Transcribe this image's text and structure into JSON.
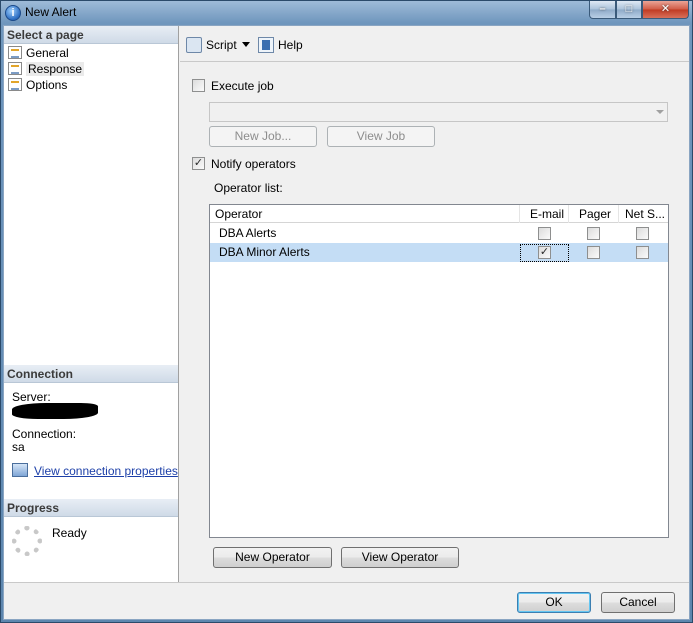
{
  "window": {
    "title": "New Alert",
    "app_icon": "info-icon",
    "controls": {
      "minimize": "minimize-icon",
      "maximize": "maximize-icon",
      "close": "close-icon"
    }
  },
  "left": {
    "select_page_header": "Select a page",
    "pages": [
      {
        "label": "General",
        "selected": false
      },
      {
        "label": "Response",
        "selected": true
      },
      {
        "label": "Options",
        "selected": false
      }
    ],
    "connection_header": "Connection",
    "server_label": "Server:",
    "connection_label": "Connection:",
    "connection_value": "sa",
    "view_props_link": "View connection properties",
    "progress_header": "Progress",
    "progress_status": "Ready"
  },
  "toolbar": {
    "script_label": "Script",
    "help_label": "Help"
  },
  "response": {
    "execute_job_label": "Execute job",
    "execute_job_checked": false,
    "job_combo_value": "",
    "new_job_label": "New Job...",
    "view_job_label": "View Job",
    "notify_operators_label": "Notify operators",
    "notify_operators_checked": true,
    "operator_list_label": "Operator list:",
    "columns": [
      "Operator",
      "E-mail",
      "Pager",
      "Net S..."
    ],
    "operators": [
      {
        "name": "DBA Alerts",
        "email": false,
        "pager": false,
        "net_send": false
      },
      {
        "name": "DBA Minor Alerts",
        "email": true,
        "pager": false,
        "net_send": false
      }
    ],
    "new_operator_label": "New Operator",
    "view_operator_label": "View Operator"
  },
  "footer": {
    "ok_label": "OK",
    "cancel_label": "Cancel"
  },
  "colors": {
    "selected_row": "#c4ddf5",
    "link": "#1c3fa8",
    "section_header": "#dde6f0"
  }
}
